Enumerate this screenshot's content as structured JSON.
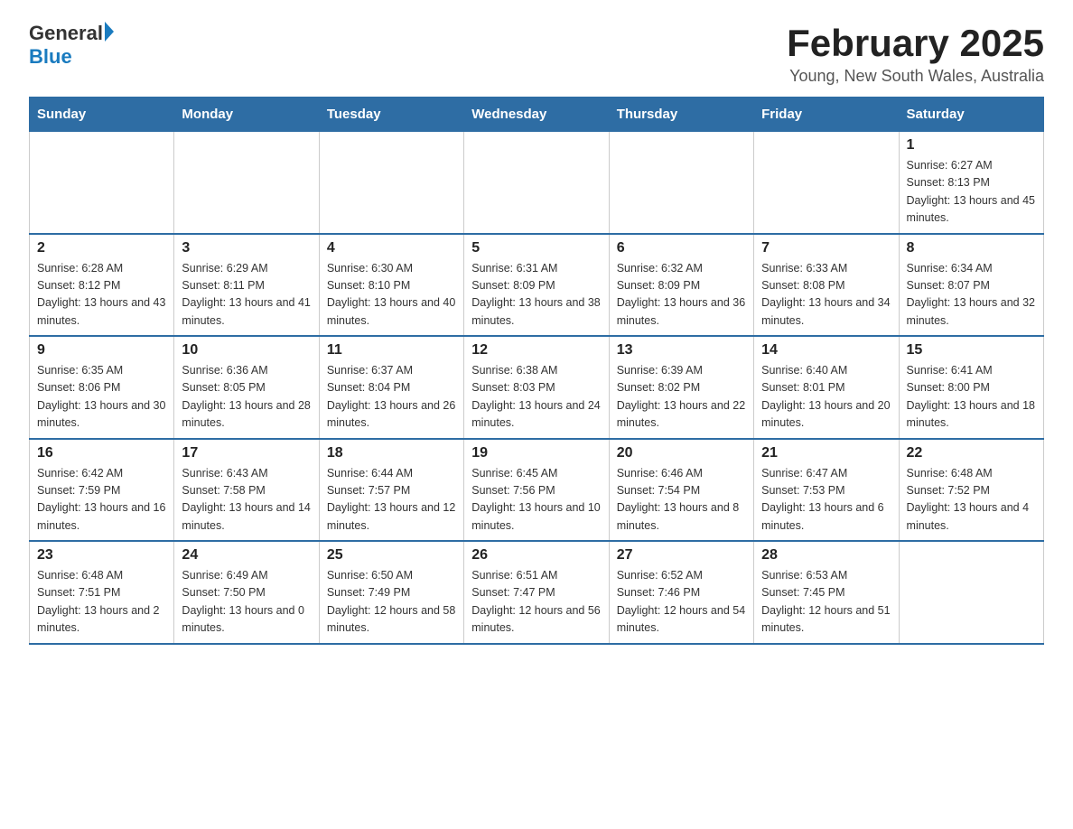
{
  "logo": {
    "general": "General",
    "blue": "Blue"
  },
  "title": "February 2025",
  "subtitle": "Young, New South Wales, Australia",
  "days_header": [
    "Sunday",
    "Monday",
    "Tuesday",
    "Wednesday",
    "Thursday",
    "Friday",
    "Saturday"
  ],
  "weeks": [
    [
      {
        "day": "",
        "info": ""
      },
      {
        "day": "",
        "info": ""
      },
      {
        "day": "",
        "info": ""
      },
      {
        "day": "",
        "info": ""
      },
      {
        "day": "",
        "info": ""
      },
      {
        "day": "",
        "info": ""
      },
      {
        "day": "1",
        "info": "Sunrise: 6:27 AM\nSunset: 8:13 PM\nDaylight: 13 hours and 45 minutes."
      }
    ],
    [
      {
        "day": "2",
        "info": "Sunrise: 6:28 AM\nSunset: 8:12 PM\nDaylight: 13 hours and 43 minutes."
      },
      {
        "day": "3",
        "info": "Sunrise: 6:29 AM\nSunset: 8:11 PM\nDaylight: 13 hours and 41 minutes."
      },
      {
        "day": "4",
        "info": "Sunrise: 6:30 AM\nSunset: 8:10 PM\nDaylight: 13 hours and 40 minutes."
      },
      {
        "day": "5",
        "info": "Sunrise: 6:31 AM\nSunset: 8:09 PM\nDaylight: 13 hours and 38 minutes."
      },
      {
        "day": "6",
        "info": "Sunrise: 6:32 AM\nSunset: 8:09 PM\nDaylight: 13 hours and 36 minutes."
      },
      {
        "day": "7",
        "info": "Sunrise: 6:33 AM\nSunset: 8:08 PM\nDaylight: 13 hours and 34 minutes."
      },
      {
        "day": "8",
        "info": "Sunrise: 6:34 AM\nSunset: 8:07 PM\nDaylight: 13 hours and 32 minutes."
      }
    ],
    [
      {
        "day": "9",
        "info": "Sunrise: 6:35 AM\nSunset: 8:06 PM\nDaylight: 13 hours and 30 minutes."
      },
      {
        "day": "10",
        "info": "Sunrise: 6:36 AM\nSunset: 8:05 PM\nDaylight: 13 hours and 28 minutes."
      },
      {
        "day": "11",
        "info": "Sunrise: 6:37 AM\nSunset: 8:04 PM\nDaylight: 13 hours and 26 minutes."
      },
      {
        "day": "12",
        "info": "Sunrise: 6:38 AM\nSunset: 8:03 PM\nDaylight: 13 hours and 24 minutes."
      },
      {
        "day": "13",
        "info": "Sunrise: 6:39 AM\nSunset: 8:02 PM\nDaylight: 13 hours and 22 minutes."
      },
      {
        "day": "14",
        "info": "Sunrise: 6:40 AM\nSunset: 8:01 PM\nDaylight: 13 hours and 20 minutes."
      },
      {
        "day": "15",
        "info": "Sunrise: 6:41 AM\nSunset: 8:00 PM\nDaylight: 13 hours and 18 minutes."
      }
    ],
    [
      {
        "day": "16",
        "info": "Sunrise: 6:42 AM\nSunset: 7:59 PM\nDaylight: 13 hours and 16 minutes."
      },
      {
        "day": "17",
        "info": "Sunrise: 6:43 AM\nSunset: 7:58 PM\nDaylight: 13 hours and 14 minutes."
      },
      {
        "day": "18",
        "info": "Sunrise: 6:44 AM\nSunset: 7:57 PM\nDaylight: 13 hours and 12 minutes."
      },
      {
        "day": "19",
        "info": "Sunrise: 6:45 AM\nSunset: 7:56 PM\nDaylight: 13 hours and 10 minutes."
      },
      {
        "day": "20",
        "info": "Sunrise: 6:46 AM\nSunset: 7:54 PM\nDaylight: 13 hours and 8 minutes."
      },
      {
        "day": "21",
        "info": "Sunrise: 6:47 AM\nSunset: 7:53 PM\nDaylight: 13 hours and 6 minutes."
      },
      {
        "day": "22",
        "info": "Sunrise: 6:48 AM\nSunset: 7:52 PM\nDaylight: 13 hours and 4 minutes."
      }
    ],
    [
      {
        "day": "23",
        "info": "Sunrise: 6:48 AM\nSunset: 7:51 PM\nDaylight: 13 hours and 2 minutes."
      },
      {
        "day": "24",
        "info": "Sunrise: 6:49 AM\nSunset: 7:50 PM\nDaylight: 13 hours and 0 minutes."
      },
      {
        "day": "25",
        "info": "Sunrise: 6:50 AM\nSunset: 7:49 PM\nDaylight: 12 hours and 58 minutes."
      },
      {
        "day": "26",
        "info": "Sunrise: 6:51 AM\nSunset: 7:47 PM\nDaylight: 12 hours and 56 minutes."
      },
      {
        "day": "27",
        "info": "Sunrise: 6:52 AM\nSunset: 7:46 PM\nDaylight: 12 hours and 54 minutes."
      },
      {
        "day": "28",
        "info": "Sunrise: 6:53 AM\nSunset: 7:45 PM\nDaylight: 12 hours and 51 minutes."
      },
      {
        "day": "",
        "info": ""
      }
    ]
  ]
}
